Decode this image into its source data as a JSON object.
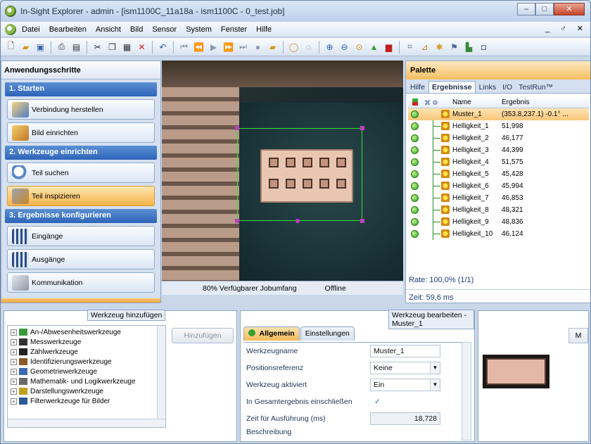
{
  "window": {
    "title": "In-Sight Explorer - admin - [ism1100C_11a18a - ism1100C - 0_test.job]",
    "controls": [
      "–",
      "□",
      "✕"
    ]
  },
  "menu": {
    "items": [
      "Datei",
      "Bearbeiten",
      "Ansicht",
      "Bild",
      "Sensor",
      "System",
      "Fenster",
      "Hilfe"
    ],
    "right": "_ ♂ ✕"
  },
  "toolbar": {
    "icons": [
      "new-icon",
      "open-icon",
      "save-icon",
      "print-icon",
      "preview-icon",
      "cut-icon",
      "copy-icon",
      "paste-icon",
      "delete-icon",
      "undo-icon",
      "first-icon",
      "prev-icon",
      "play-icon",
      "fast-forward-icon",
      "last-icon",
      "record-icon",
      "folder-icon",
      "live-icon",
      "trigger-icon",
      "zoom-in-icon",
      "zoom-out-icon",
      "zoom-fit-icon",
      "map-icon",
      "chart-icon",
      "grid-icon",
      "calibrate-icon",
      "settings-icon",
      "network-icon",
      "sensor-icon"
    ]
  },
  "left": {
    "header": "Anwendungsschritte",
    "section1": "1. Starten",
    "step_connect": "Verbindung herstellen",
    "step_image": "Bild einrichten",
    "section2": "2. Werkzeuge einrichten",
    "step_find": "Teil suchen",
    "step_inspect": "Teil inspizieren",
    "section3": "3. Ergebnisse konfigurieren",
    "step_inputs": "Eingänge",
    "step_outputs": "Ausgänge",
    "step_comm": "Kommunikation"
  },
  "viewer": {
    "status_capacity": "80% Verfügbarer Jobumfang",
    "status_mode": "Offline"
  },
  "palette": {
    "header": "Palette",
    "tabs": [
      "Hilfe",
      "Ergebnisse",
      "Links",
      "I/O",
      "TestRun™"
    ],
    "col_name": "Name",
    "col_result": "Ergebnis",
    "rows": [
      {
        "name": "Muster_1",
        "value": "(353.8,237.1) -0.1° ..."
      },
      {
        "name": "Helligkeit_1",
        "value": "51,998"
      },
      {
        "name": "Helligkeit_2",
        "value": "46,177"
      },
      {
        "name": "Helligkeit_3",
        "value": "44,399"
      },
      {
        "name": "Helligkeit_4",
        "value": "51,575"
      },
      {
        "name": "Helligkeit_5",
        "value": "45,428"
      },
      {
        "name": "Helligkeit_6",
        "value": "45,994"
      },
      {
        "name": "Helligkeit_7",
        "value": "46,853"
      },
      {
        "name": "Helligkeit_8",
        "value": "48,321"
      },
      {
        "name": "Helligkeit_9",
        "value": "48,836"
      },
      {
        "name": "Helligkeit_10",
        "value": "46,124"
      }
    ],
    "rate": "Rate: 100,0% (1/1)",
    "zeit": "Zeit: 59,6 ms"
  },
  "add_tool": {
    "label": "Werkzeug hinzufügen",
    "button": "Hinzufügen",
    "tree": [
      "An-/Abwesenheitswerkzeuge",
      "Messwerkzeuge",
      "Zählwerkzeuge",
      "Identifizierungswerkzeuge",
      "Geometriewerkzeuge",
      "Mathematik- und Logikwerkzeuge",
      "Darstellungswerkzeuge",
      "Filterwerkzeuge für Bilder"
    ]
  },
  "edit_tool": {
    "label": "Werkzeug bearbeiten - Muster_1",
    "tab_general": "Allgemein",
    "tab_settings": "Einstellungen",
    "props": [
      {
        "label": "Werkzeugname",
        "value": "Muster_1"
      },
      {
        "label": "Positionsreferenz",
        "value": "Keine"
      },
      {
        "label": "Werkzeug aktiviert",
        "value": "Ein"
      },
      {
        "label": "In Gesamtergebnis einschließen",
        "value": "✓"
      },
      {
        "label": "Zeit für Ausführung (ms)",
        "value": "18,728"
      },
      {
        "label": "Beschreibung",
        "value": ""
      }
    ]
  },
  "preview": {
    "button": "M"
  }
}
